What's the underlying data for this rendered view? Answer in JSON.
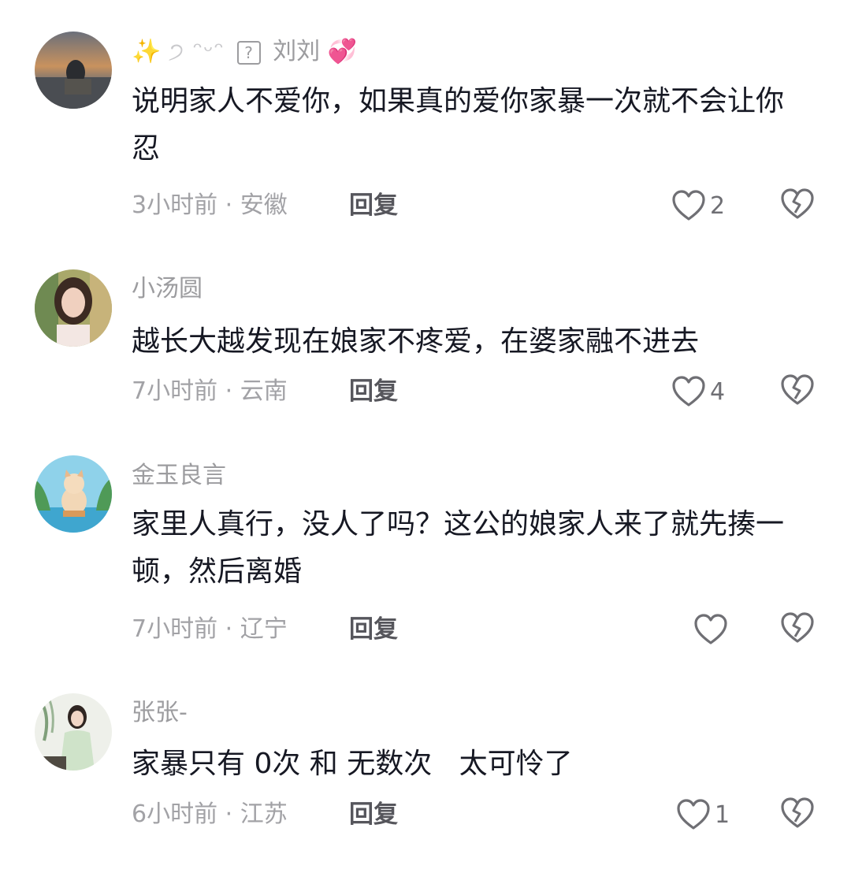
{
  "colors": {
    "username": "#9c9c9f",
    "text": "#161823",
    "meta": "#a2a2a6",
    "icon": "#6f6f74"
  },
  "comments": [
    {
      "username_prefix": "✨",
      "username_masked": "੭ ᵔᵕᵔ",
      "username_name": "刘刘",
      "username_suffix": "💞",
      "text": "说明家人不爱你，如果真的爱你家暴一次就不会让你忍",
      "meta": "3小时前 · 安徽",
      "reply": "回复",
      "likes": "2",
      "like_icon": "heart-outline-icon",
      "dislike_icon": "broken-heart-icon"
    },
    {
      "username": "小汤圆",
      "text": "越长大越发现在娘家不疼爱，在婆家融不进去",
      "meta": "7小时前 · 云南",
      "reply": "回复",
      "likes": "4"
    },
    {
      "username": "金玉良言",
      "text": "家里人真行，没人了吗？这公的娘家人来了就先揍一顿，然后离婚",
      "meta": "7小时前 · 辽宁",
      "reply": "回复",
      "likes": ""
    },
    {
      "username": "张张-",
      "text": "家暴只有 0次 和 无数次   太可怜了",
      "meta": "6小时前 · 江苏",
      "reply": "回复",
      "likes": "1"
    }
  ]
}
